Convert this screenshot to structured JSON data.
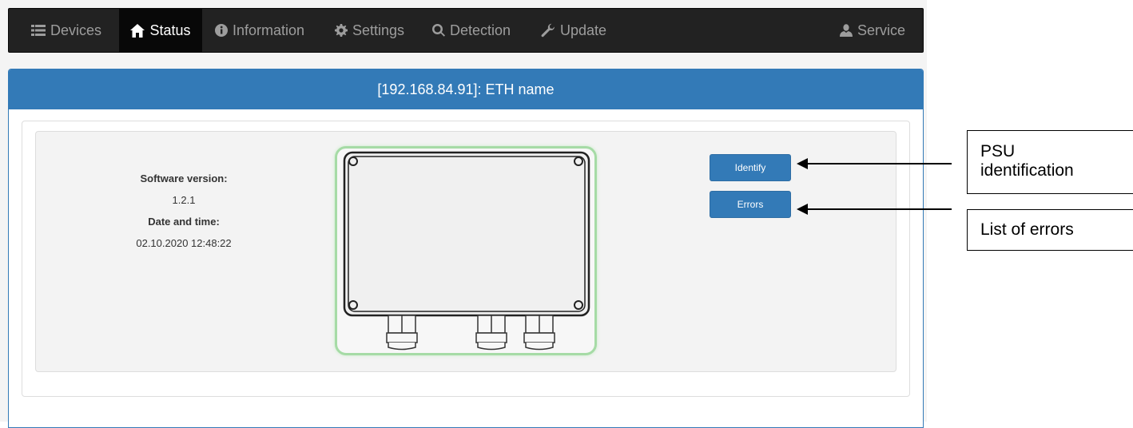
{
  "nav": {
    "items": [
      {
        "label": "Devices",
        "icon": "list-icon"
      },
      {
        "label": "Status",
        "icon": "home-icon",
        "active": true
      },
      {
        "label": "Information",
        "icon": "info-icon"
      },
      {
        "label": "Settings",
        "icon": "gear-icon"
      },
      {
        "label": "Detection",
        "icon": "search-icon"
      },
      {
        "label": "Update",
        "icon": "wrench-icon"
      }
    ],
    "service": {
      "label": "Service",
      "icon": "user-icon"
    }
  },
  "panel": {
    "title": "[192.168.84.91]: ETH name"
  },
  "info": {
    "software_label": "Software version:",
    "software_value": "1.2.1",
    "datetime_label": "Date and time:",
    "datetime_value": "02.10.2020 12:48:22"
  },
  "buttons": {
    "identify": "Identify",
    "errors": "Errors"
  },
  "callouts": {
    "psu_line1": "PSU",
    "psu_line2": "identification",
    "errors": "List of errors"
  },
  "colors": {
    "navbar": "#222222",
    "primary": "#337ab7",
    "device_glow": "#a6dba6"
  }
}
